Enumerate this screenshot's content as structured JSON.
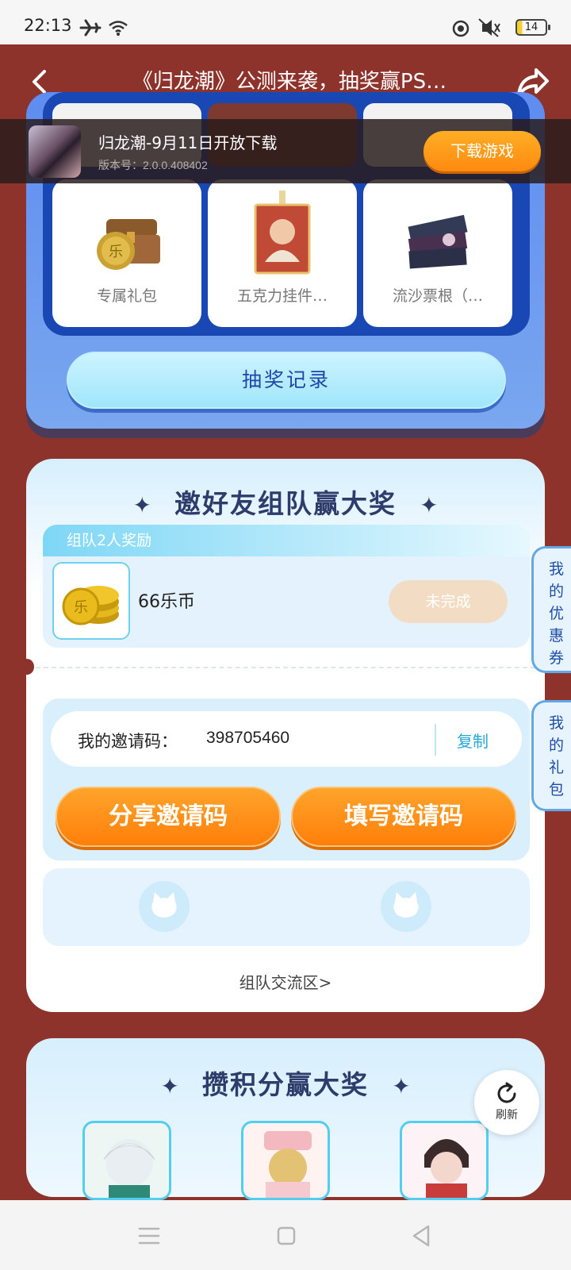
{
  "status_bar": {
    "time": "22:13",
    "icons": [
      "airplane-icon",
      "wifi-icon",
      "focus-icon",
      "vibrate-icon"
    ],
    "battery": "14"
  },
  "header": {
    "title": "《归龙潮》公测来袭，抽奖赢PS…"
  },
  "game_banner": {
    "name": "归龙潮-9月11日开放下载",
    "version": "版本号：2.0.0.408402",
    "download_label": "下载游戏"
  },
  "lottery": {
    "prizes": [
      {
        "label": "专属礼包",
        "icon": "gift-chest-icon"
      },
      {
        "label": "五克力挂件…",
        "icon": "charm-icon"
      },
      {
        "label": "流沙票根（…",
        "icon": "ticket-icon"
      }
    ],
    "record_label": "抽奖记录"
  },
  "team": {
    "title": "邀好友组队赢大奖",
    "reward_tab": "组队2人奖励",
    "reward_name": "66乐币",
    "reward_status": "未完成",
    "invite_label": "我的邀请码：",
    "invite_code": "398705460",
    "copy_label": "复制",
    "share_label": "分享邀请码",
    "fill_label": "填写邀请码",
    "link_label": "组队交流区>"
  },
  "side_tabs": {
    "coupons": "我的优惠券",
    "gifts": "我的礼包"
  },
  "points": {
    "title": "攒积分赢大奖",
    "refresh_label": "刷新"
  },
  "colors": {
    "background": "#8e322c",
    "accent_orange": "#ff8a10",
    "panel_blue": "#1947b3",
    "title_navy": "#2d3c6a"
  }
}
